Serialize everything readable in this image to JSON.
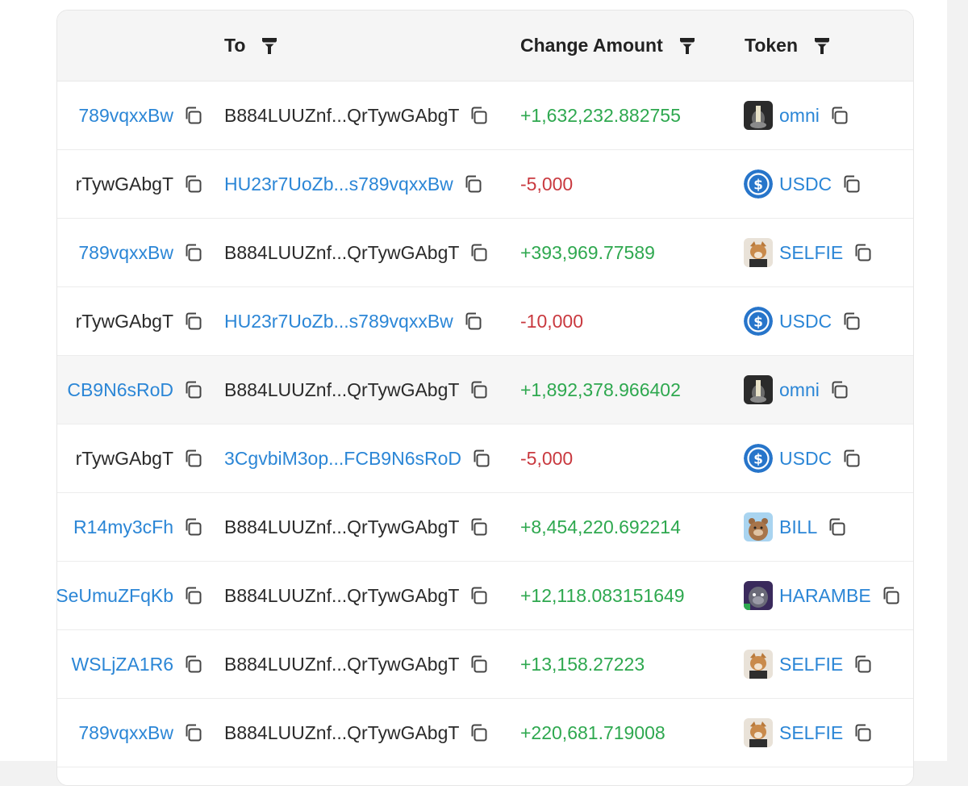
{
  "columns": {
    "to": "To",
    "change_amount": "Change Amount",
    "token": "Token"
  },
  "rows": [
    {
      "from": "789vqxxBw",
      "from_style": "link",
      "to": "B884LUUZnf...QrTywGAbgT",
      "to_style": "plain",
      "amount": "+1,632,232.882755",
      "amount_sign": "pos",
      "token": "omni",
      "token_icon": "omni-token-icon"
    },
    {
      "from": "rTywGAbgT",
      "from_style": "plain",
      "to": "HU23r7UoZb...s789vqxxBw",
      "to_style": "link",
      "amount": "-5,000",
      "amount_sign": "neg",
      "token": "USDC",
      "token_icon": "usdc-token-icon"
    },
    {
      "from": "789vqxxBw",
      "from_style": "link",
      "to": "B884LUUZnf...QrTywGAbgT",
      "to_style": "plain",
      "amount": "+393,969.77589",
      "amount_sign": "pos",
      "token": "SELFIE",
      "token_icon": "selfie-token-icon"
    },
    {
      "from": "rTywGAbgT",
      "from_style": "plain",
      "to": "HU23r7UoZb...s789vqxxBw",
      "to_style": "link",
      "amount": "-10,000",
      "amount_sign": "neg",
      "token": "USDC",
      "token_icon": "usdc-token-icon"
    },
    {
      "from": "CB9N6sRoD",
      "from_style": "link",
      "to": "B884LUUZnf...QrTywGAbgT",
      "to_style": "plain",
      "amount": "+1,892,378.966402",
      "amount_sign": "pos",
      "token": "omni",
      "token_icon": "omni-token-icon",
      "highlighted": true
    },
    {
      "from": "rTywGAbgT",
      "from_style": "plain",
      "to": "3CgvbiM3op...FCB9N6sRoD",
      "to_style": "link",
      "amount": "-5,000",
      "amount_sign": "neg",
      "token": "USDC",
      "token_icon": "usdc-token-icon"
    },
    {
      "from": "R14my3cFh",
      "from_style": "link",
      "to": "B884LUUZnf...QrTywGAbgT",
      "to_style": "plain",
      "amount": "+8,454,220.692214",
      "amount_sign": "pos",
      "token": "BILL",
      "token_icon": "bill-token-icon"
    },
    {
      "from": "SeUmuZFqKb",
      "from_style": "link",
      "to": "B884LUUZnf...QrTywGAbgT",
      "to_style": "plain",
      "amount": "+12,118.083151649",
      "amount_sign": "pos",
      "token": "HARAMBE",
      "token_icon": "harambe-token-icon"
    },
    {
      "from": "WSLjZA1R6",
      "from_style": "link",
      "to": "B884LUUZnf...QrTywGAbgT",
      "to_style": "plain",
      "amount": "+13,158.27223",
      "amount_sign": "pos",
      "token": "SELFIE",
      "token_icon": "selfie-token-icon"
    },
    {
      "from": "789vqxxBw",
      "from_style": "link",
      "to": "B884LUUZnf...QrTywGAbgT",
      "to_style": "plain",
      "amount": "+220,681.719008",
      "amount_sign": "pos",
      "token": "SELFIE",
      "token_icon": "selfie-token-icon"
    }
  ],
  "colors": {
    "link": "#2b86d6",
    "positive": "#2ea84f",
    "negative": "#c9393f",
    "usdc": "#2775ca"
  }
}
